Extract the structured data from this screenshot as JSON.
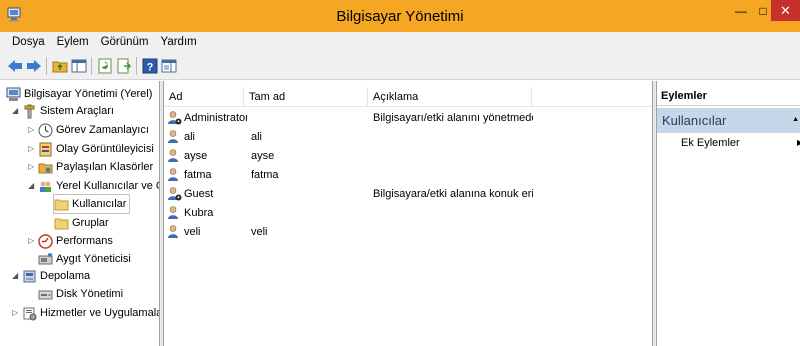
{
  "window": {
    "title": "Bilgisayar Yönetimi",
    "min_symbol": "—",
    "max_symbol": "□",
    "close_symbol": "✕"
  },
  "menu": [
    "Dosya",
    "Eylem",
    "Görünüm",
    "Yardım"
  ],
  "toolbar": {
    "icons": [
      "back-arrow-icon",
      "forward-arrow-icon",
      "up-folder-icon",
      "show-hide-tree-icon",
      "refresh-icon",
      "export-list-icon",
      "help-icon",
      "show-action-pane-icon"
    ]
  },
  "tree": [
    {
      "label": "Bilgisayar Yönetimi (Yerel)",
      "icon": "computer-icon"
    },
    {
      "label": "Sistem Araçları",
      "icon": "tools-icon"
    },
    {
      "label": "Görev Zamanlayıcı",
      "icon": "clock-icon"
    },
    {
      "label": "Olay Görüntüleyicisi",
      "icon": "event-viewer-icon"
    },
    {
      "label": "Paylaşılan Klasörler",
      "icon": "shared-folder-icon"
    },
    {
      "label": "Yerel Kullanıcılar ve Gru",
      "icon": "users-icon"
    },
    {
      "label": "Kullanıcılar",
      "icon": "folder-icon"
    },
    {
      "label": "Gruplar",
      "icon": "folder-icon"
    },
    {
      "label": "Performans",
      "icon": "performance-icon"
    },
    {
      "label": "Aygıt Yöneticisi",
      "icon": "device-manager-icon"
    },
    {
      "label": "Depolama",
      "icon": "storage-icon"
    },
    {
      "label": "Disk Yönetimi",
      "icon": "disk-icon"
    },
    {
      "label": "Hizmetler ve Uygulamalar",
      "icon": "services-icon"
    }
  ],
  "list": {
    "columns": [
      "Ad",
      "Tam ad",
      "Açıklama"
    ],
    "rows": [
      {
        "name": "Administrator",
        "full_name": "",
        "description": "Bilgisayarı/etki alanını yönetmede..."
      },
      {
        "name": "ali",
        "full_name": "ali",
        "description": ""
      },
      {
        "name": "ayse",
        "full_name": "ayse",
        "description": ""
      },
      {
        "name": "fatma",
        "full_name": "fatma",
        "description": ""
      },
      {
        "name": "Guest",
        "full_name": "",
        "description": "Bilgisayara/etki alanına konuk eriş..."
      },
      {
        "name": "Kubra",
        "full_name": "",
        "description": ""
      },
      {
        "name": "veli",
        "full_name": "veli",
        "description": ""
      }
    ]
  },
  "actions": {
    "title": "Eylemler",
    "section": "Kullanıcılar",
    "items": [
      "Ek Eylemler"
    ]
  },
  "colors": {
    "titlebar": "#f5a623",
    "close": "#c7302b",
    "action_section": "#c7d7ea"
  }
}
